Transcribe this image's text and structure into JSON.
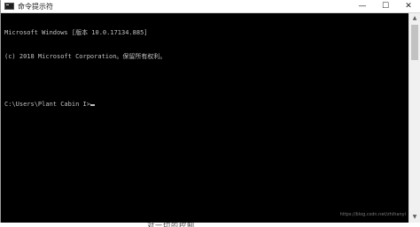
{
  "window": {
    "title": "命令提示符",
    "icon": "cmd-icon",
    "controls": {
      "minimize": "—",
      "maximize": "☐",
      "close": "✕"
    }
  },
  "console": {
    "lines": [
      "Microsoft Windows [版本 10.0.17134.885]",
      "(c) 2018 Microsoft Corporation。保留所有权利。",
      "",
      "C:\\Users\\Plant Cabin I>"
    ]
  },
  "scrollbar": {
    "up": "▲",
    "down": "▼"
  },
  "watermark": "https://blog.csdn.net/zhihanyi",
  "below_text": "对一切的控制"
}
